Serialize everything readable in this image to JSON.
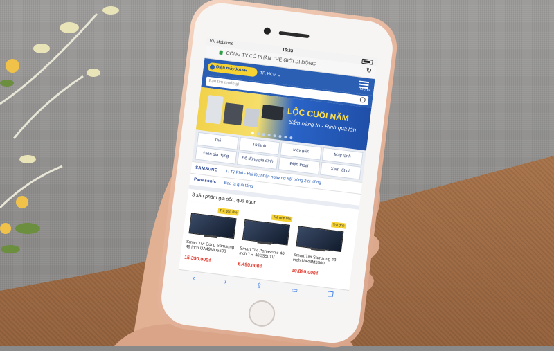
{
  "status_bar": {
    "carrier": "VN Mobifone",
    "time": "16:23"
  },
  "address_bar": {
    "url_text": "CÔNG TY CỔ PHẦN THẾ GIỚI DI ĐỘNG"
  },
  "site_header": {
    "region": "TP. HCM ⌄",
    "menu_label": "Menu"
  },
  "search": {
    "placeholder": "Bạn tìm muốn gì"
  },
  "banner": {
    "title": "LỘC CUỐI NĂM",
    "subtitle": "Sắm hàng to - Rinh quà lớn"
  },
  "categories": [
    "Tivi",
    "Tủ lạnh",
    "Máy giặt",
    "Máy lạnh",
    "Điện gia dụng",
    "Đồ dùng gia đình",
    "Điện thoại",
    "Xem tất cả"
  ],
  "brands": [
    {
      "name": "SAMSUNG",
      "text": "Tỉ Tỷ Phú - Hài lộc nhận ngay cơ hội trúng 2 tỷ đồng"
    },
    {
      "name": "Panasonic",
      "text": "Bao la quà tặng"
    }
  ],
  "products_section": {
    "title": "8 sản phẩm giá sốc, quá ngon",
    "items": [
      {
        "tag": "Trả góp 0%",
        "name": "Smart Tivi Cong Samsung 49 inch UA49MU6500",
        "price": "15.390.000₫"
      },
      {
        "tag": "Trả góp 0%",
        "name": "Smart Tivi Panasonic 40 inch TH-40ES501V",
        "price": "6.490.000₫"
      },
      {
        "tag": "Trả góp",
        "name": "Smart Tivi Samsung 43 inch UA43M5500",
        "price": "10.890.000₫"
      }
    ]
  },
  "colors": {
    "site_blue": "#2b5fb4",
    "banner_yellow": "#f6d233",
    "price_red": "#e03a2e",
    "phone_gold": "#e7b79e"
  }
}
